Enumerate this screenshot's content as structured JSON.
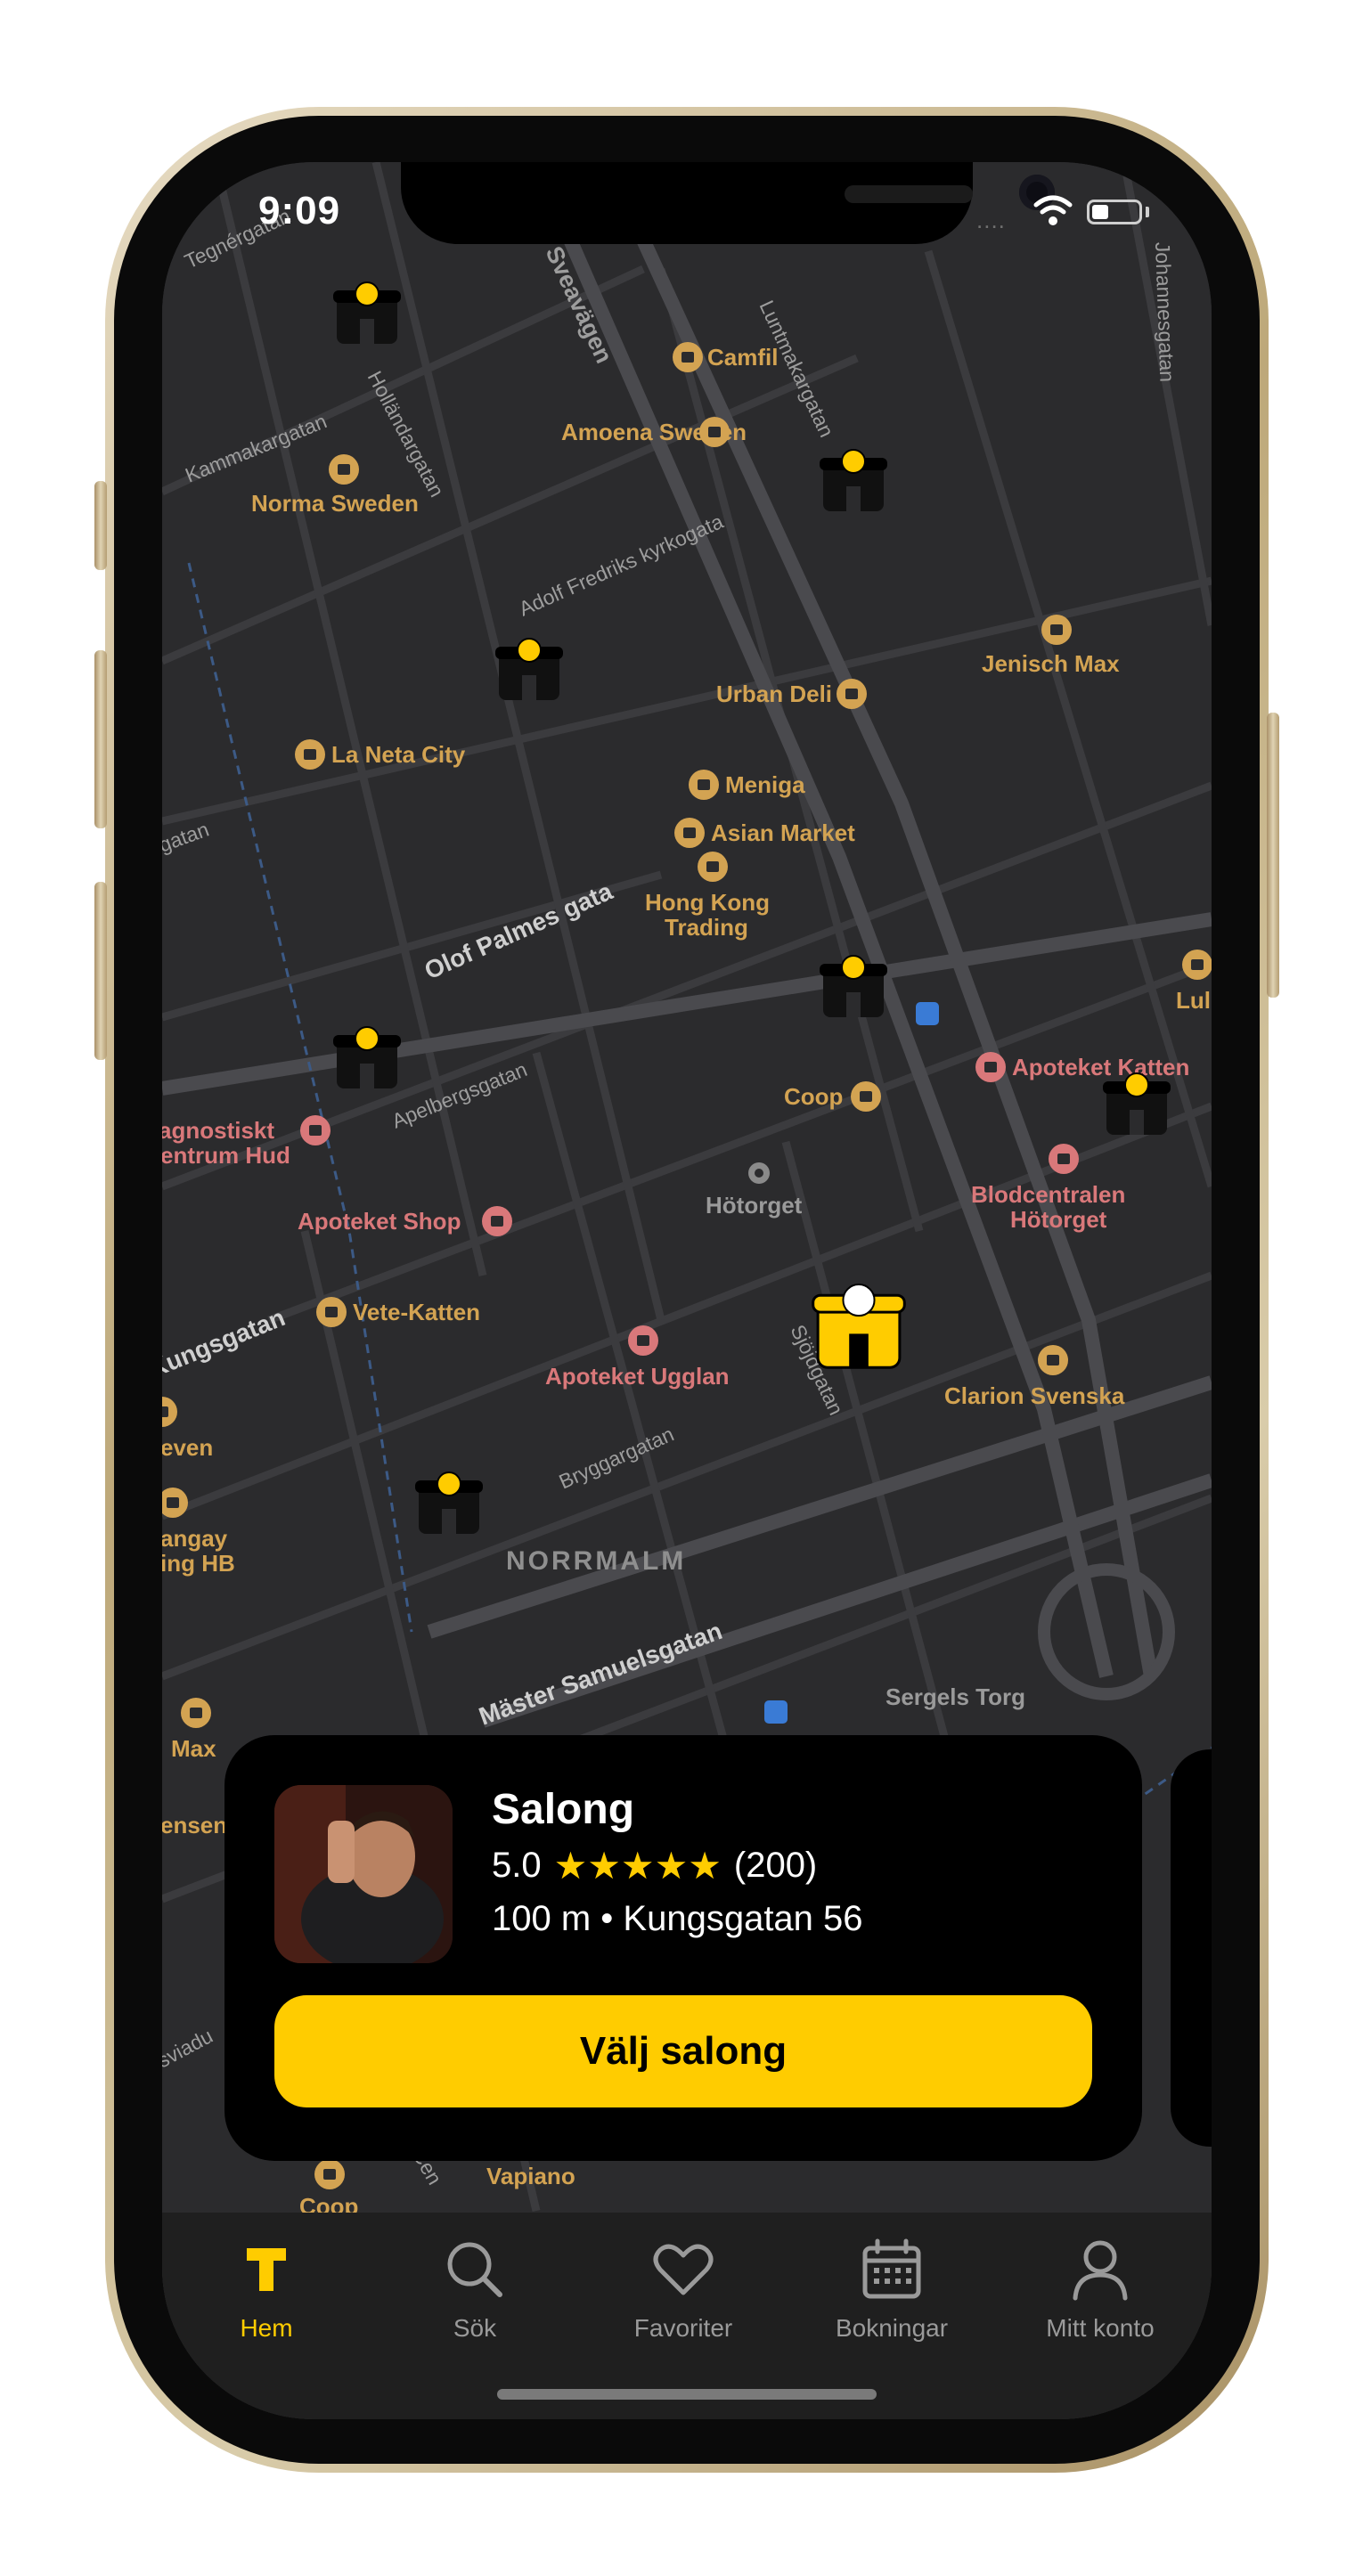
{
  "status_bar": {
    "time": "9:09",
    "signal": "....",
    "battery_level": 0.35
  },
  "map": {
    "street_labels": [
      {
        "id": "s1",
        "text": "Tegnérgatan"
      },
      {
        "id": "s2",
        "text": "Sveavägen"
      },
      {
        "id": "s3",
        "text": "Luntmakargatan"
      },
      {
        "id": "s4",
        "text": "Johannesgatan"
      },
      {
        "id": "s5",
        "text": "Kammakargatan"
      },
      {
        "id": "s6",
        "text": "Holländargatan"
      },
      {
        "id": "s7",
        "text": "Adolf Fredriks kyrkogata"
      },
      {
        "id": "s8",
        "text": "Olof Palmes gata"
      },
      {
        "id": "s9",
        "text": "Apelbergsgatan"
      },
      {
        "id": "s10",
        "text": "Sjöjdgatan"
      },
      {
        "id": "s11",
        "text": "Bryggargatan"
      },
      {
        "id": "s12",
        "text": "Kungsgatan"
      },
      {
        "id": "s13",
        "text": "Mäster Samuelsgatan"
      },
      {
        "id": "s14",
        "text": "gatan"
      },
      {
        "id": "s15",
        "text": "sviadu"
      },
      {
        "id": "s16",
        "text": "Cen"
      }
    ],
    "area_labels": {
      "norrmalm": "NORRMALM",
      "hotorget": "Hötorget",
      "sergels": "Sergels Torg"
    },
    "pois": [
      {
        "id": "p1",
        "text": "Camfil",
        "icon": "shopping-bag-icon",
        "tone": "gold"
      },
      {
        "id": "p2",
        "text": "Amoena Sweden",
        "icon": "shopping-bag-icon",
        "tone": "gold"
      },
      {
        "id": "p3",
        "text": "Norma Sweden",
        "icon": "shopping-bag-icon",
        "tone": "gold"
      },
      {
        "id": "p4",
        "text": "Jenisch Max",
        "icon": "shopping-bag-icon",
        "tone": "gold"
      },
      {
        "id": "p5",
        "text": "Urban Deli",
        "icon": "fork-knife-icon",
        "tone": "gold"
      },
      {
        "id": "p6",
        "text": "La Neta City",
        "icon": "fork-knife-icon",
        "tone": "gold"
      },
      {
        "id": "p7",
        "text": "Meniga",
        "icon": "shopping-bag-icon",
        "tone": "gold"
      },
      {
        "id": "p8",
        "text": "Asian Market",
        "icon": "cart-icon",
        "tone": "gold"
      },
      {
        "id": "p9",
        "text": "Hong Kong",
        "icon": "cart-icon",
        "tone": "gold"
      },
      {
        "id": "p9b",
        "text": "Trading",
        "icon": "",
        "tone": "gold"
      },
      {
        "id": "p10",
        "text": "Coop",
        "icon": "cart-icon",
        "tone": "gold"
      },
      {
        "id": "p11",
        "text": "Apoteket Katten",
        "icon": "pill-icon",
        "tone": "pink"
      },
      {
        "id": "p12",
        "text": "Blodcentralen",
        "icon": "medical-cross-icon",
        "tone": "pink"
      },
      {
        "id": "p12b",
        "text": "Hötorget",
        "icon": "",
        "tone": "pink"
      },
      {
        "id": "p13",
        "text": "agnostiskt",
        "icon": "stethoscope-icon",
        "tone": "pink"
      },
      {
        "id": "p13b",
        "text": "entrum Hud",
        "icon": "",
        "tone": "pink"
      },
      {
        "id": "p14",
        "text": "Apoteket Shop",
        "icon": "pill-icon",
        "tone": "pink"
      },
      {
        "id": "p15",
        "text": "Vete-Katten",
        "icon": "croissant-icon",
        "tone": "gold"
      },
      {
        "id": "p16",
        "text": "Apoteket Ugglan",
        "icon": "pill-icon",
        "tone": "pink"
      },
      {
        "id": "p17",
        "text": "Clarion Svenska",
        "icon": "shopping-bag-icon",
        "tone": "gold"
      },
      {
        "id": "p18",
        "text": "even",
        "icon": "shopping-bag-icon",
        "tone": "gold"
      },
      {
        "id": "p19",
        "text": "angay",
        "icon": "cart-icon",
        "tone": "gold"
      },
      {
        "id": "p19b",
        "text": "ing HB",
        "icon": "",
        "tone": "gold"
      },
      {
        "id": "p20",
        "text": "Max",
        "icon": "fork-knife-icon",
        "tone": "gold"
      },
      {
        "id": "p21",
        "text": "ensen",
        "icon": "",
        "tone": "gold"
      },
      {
        "id": "p22",
        "text": "Lul",
        "icon": "shopping-bag-icon",
        "tone": "gold"
      },
      {
        "id": "p23",
        "text": "Vapiano",
        "icon": "fork-knife-icon",
        "tone": "gold"
      },
      {
        "id": "p24",
        "text": "Coop",
        "icon": "cart-icon",
        "tone": "gold"
      }
    ],
    "salon_pin_count": 7
  },
  "salon_card": {
    "name": "Salong",
    "rating": "5.0",
    "stars": "★★★★★",
    "review_count": "(200)",
    "distance_address": "100 m • Kungsgatan 56",
    "button_label": "Välj salong",
    "colors": {
      "accent": "#FFCC00",
      "card": "#000000"
    }
  },
  "tabbar": {
    "items": [
      {
        "label": "Hem",
        "icon": "home-logo-icon",
        "active": true
      },
      {
        "label": "Sök",
        "icon": "search-icon",
        "active": false
      },
      {
        "label": "Favoriter",
        "icon": "heart-icon",
        "active": false
      },
      {
        "label": "Bokningar",
        "icon": "calendar-icon",
        "active": false
      },
      {
        "label": "Mitt konto",
        "icon": "person-icon",
        "active": false
      }
    ]
  }
}
